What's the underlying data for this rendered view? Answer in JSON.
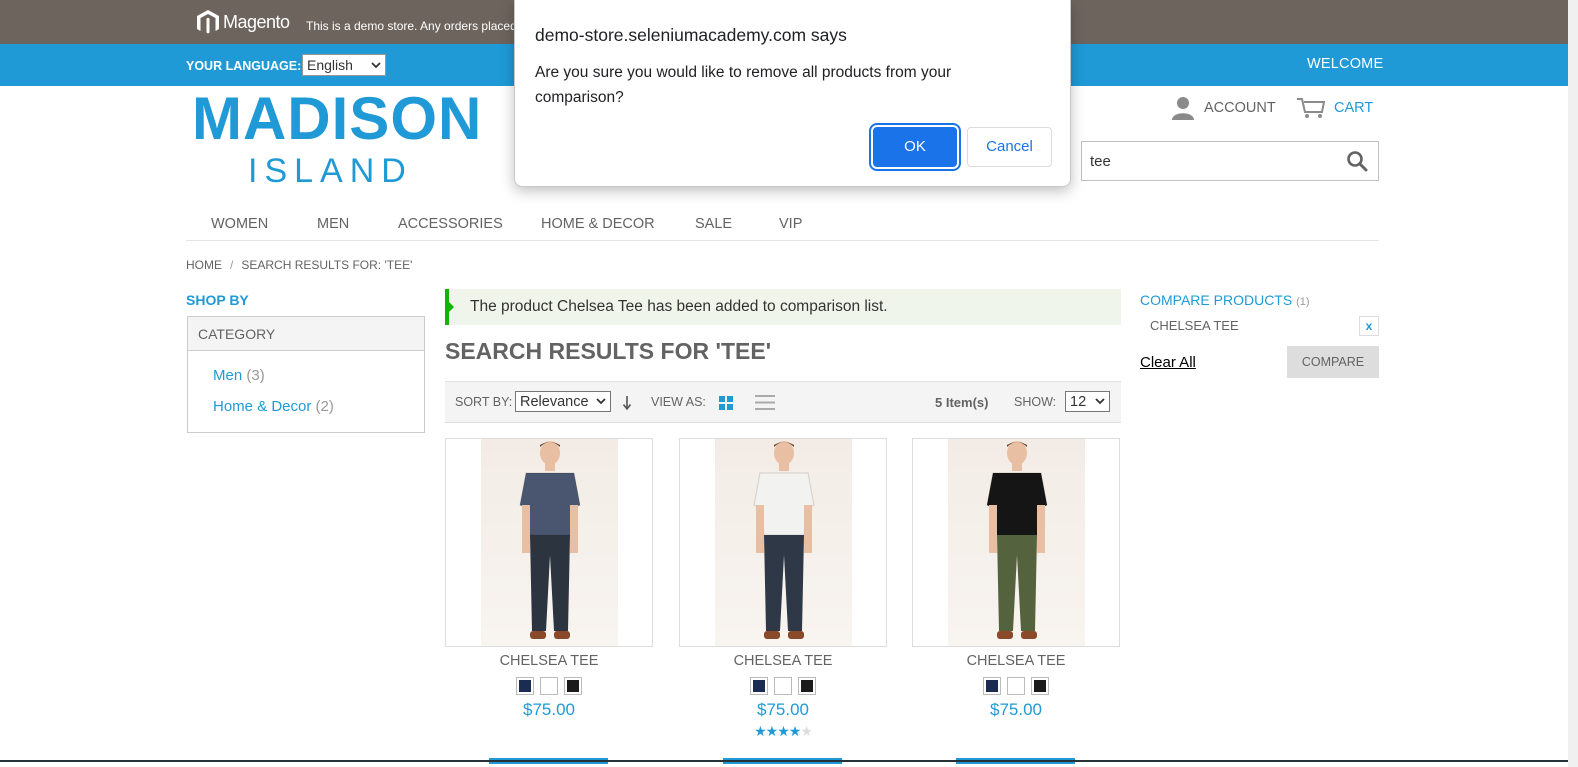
{
  "demo_bar": {
    "logo_text": "Magento",
    "notice": "This is a demo store. Any orders placed"
  },
  "lang_bar": {
    "label": "YOUR LANGUAGE:",
    "language": "English",
    "welcome": "WELCOME"
  },
  "brand": {
    "line1": "MADISON",
    "line2": "ISLAND"
  },
  "header": {
    "account": "ACCOUNT",
    "cart": "CART"
  },
  "search": {
    "value": "tee"
  },
  "nav": [
    "WOMEN",
    "MEN",
    "ACCESSORIES",
    "HOME & DECOR",
    "SALE",
    "VIP"
  ],
  "breadcrumb": {
    "home": "HOME",
    "sep": "/",
    "current": "SEARCH RESULTS FOR: 'TEE'"
  },
  "sidebar": {
    "shop_by": "SHOP BY",
    "category_heading": "CATEGORY",
    "categories": [
      {
        "label": "Men",
        "count": "(3)"
      },
      {
        "label": "Home & Decor",
        "count": "(2)"
      }
    ]
  },
  "message": "The product Chelsea Tee has been added to comparison list.",
  "results_title": "SEARCH RESULTS FOR 'TEE'",
  "toolbar": {
    "sort_label": "SORT BY:",
    "sort_value": "Relevance",
    "view_label": "VIEW AS:",
    "items": "5 Item(s)",
    "show_label": "SHOW:",
    "show_value": "12"
  },
  "products": [
    {
      "name": "CHELSEA TEE",
      "price": "$75.00",
      "shirt": "#4a5670",
      "pants": "#2c3440",
      "rating": 0
    },
    {
      "name": "CHELSEA TEE",
      "price": "$75.00",
      "shirt": "#f2f2f0",
      "pants": "#2e3846",
      "rating": 4
    },
    {
      "name": "CHELSEA TEE",
      "price": "$75.00",
      "shirt": "#151515",
      "pants": "#55623e",
      "rating": 0
    }
  ],
  "swatch_colors": [
    "#1c2b52",
    "#ffffff",
    "#1b1b1b"
  ],
  "compare": {
    "title": "COMPARE PRODUCTS",
    "count": "(1)",
    "item": "CHELSEA TEE",
    "remove": "x",
    "clear_all": "Clear All",
    "compare_button": "COMPARE"
  },
  "dialog": {
    "title": "demo-store.seleniumacademy.com says",
    "message": "Are you sure you would like to remove all products from your comparison?",
    "ok": "OK",
    "cancel": "Cancel"
  },
  "colors": {
    "brand_blue": "#1f9ad6",
    "topbar": "#6d645e",
    "success": "#11b400",
    "dialog_blue": "#1a73e8"
  }
}
